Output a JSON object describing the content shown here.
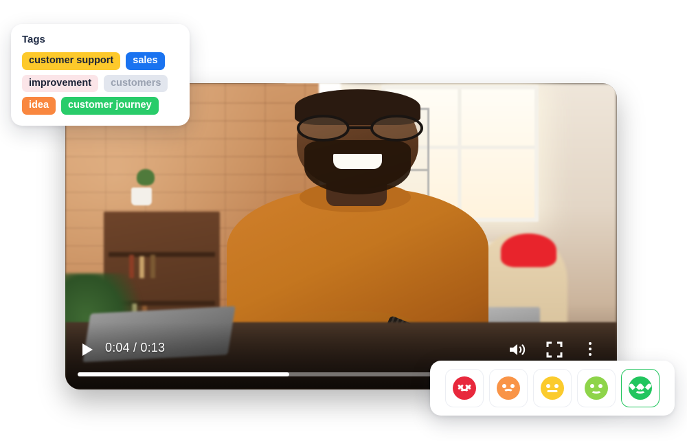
{
  "tags_card": {
    "title": "Tags",
    "tags": [
      {
        "label": "customer support",
        "bg": "#fdc92b",
        "fg": "#1b2236"
      },
      {
        "label": "sales",
        "bg": "#1a73f0",
        "fg": "#ffffff"
      },
      {
        "label": "improvement",
        "bg": "#fbe5e8",
        "fg": "#1b2236"
      },
      {
        "label": "customers",
        "bg": "#e2e6ee",
        "fg": "#9aa2b1"
      },
      {
        "label": "idea",
        "bg": "#f9873f",
        "fg": "#ffffff"
      },
      {
        "label": "customer journey",
        "bg": "#29cc6a",
        "fg": "#ffffff"
      }
    ]
  },
  "video_player": {
    "scene_description": "Smiling man with glasses in an orange sweater at an office table; brick wall, bookshelf and plant behind him; coworker in a red beanie works on a laptop by a bright window",
    "controls": {
      "play_label": "play-icon",
      "current_time": "0:04",
      "duration": "0:13",
      "time_display": "0:04 / 0:13",
      "volume_label": "volume-icon",
      "fullscreen_label": "fullscreen-icon",
      "more_label": "more-options-icon",
      "progress_percent": 40
    }
  },
  "reaction_bar": {
    "selected_index": 4,
    "reactions": [
      {
        "name": "angry",
        "color": "#e8283c",
        "eyes": "x",
        "mouth": "frown"
      },
      {
        "name": "sad",
        "color": "#f99447",
        "eyes": "dots",
        "mouth": "frown"
      },
      {
        "name": "neutral",
        "color": "#fbcb2d",
        "eyes": "dots",
        "mouth": "flat"
      },
      {
        "name": "happy",
        "color": "#8ed44a",
        "eyes": "dots",
        "mouth": "smile"
      },
      {
        "name": "love",
        "color": "#22c55e",
        "eyes": "heart",
        "mouth": "smile"
      }
    ]
  }
}
